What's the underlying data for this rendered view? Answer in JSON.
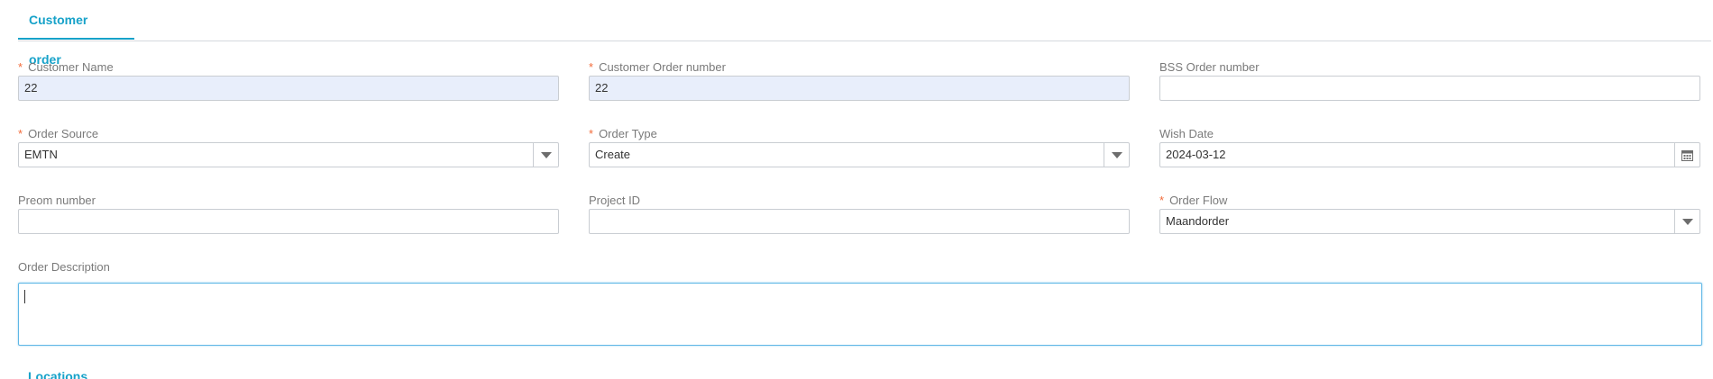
{
  "tabs": [
    {
      "label": "Customer order",
      "active": true
    }
  ],
  "form": {
    "customer_name": {
      "label": "Customer Name",
      "required": true,
      "value": "22"
    },
    "customer_order_number": {
      "label": "Customer Order number",
      "required": true,
      "value": "22"
    },
    "bss_order_number": {
      "label": "BSS Order number",
      "required": false,
      "value": ""
    },
    "order_source": {
      "label": "Order Source",
      "required": true,
      "value": "EMTN"
    },
    "order_type": {
      "label": "Order Type",
      "required": true,
      "value": "Create"
    },
    "wish_date": {
      "label": "Wish Date",
      "required": false,
      "value": "2024-03-12"
    },
    "preom_number": {
      "label": "Preom number",
      "required": false,
      "value": ""
    },
    "project_id": {
      "label": "Project ID",
      "required": false,
      "value": ""
    },
    "order_flow": {
      "label": "Order Flow",
      "required": true,
      "value": "Maandorder"
    },
    "order_description": {
      "label": "Order Description",
      "required": false,
      "value": ""
    }
  },
  "next_section": {
    "label": "Locations"
  },
  "colors": {
    "accent": "#17a2c9",
    "required": "#f26b3a",
    "filled_bg": "#e8eefb"
  },
  "icons": {
    "dropdown": "caret-down-icon",
    "calendar": "calendar-icon"
  }
}
